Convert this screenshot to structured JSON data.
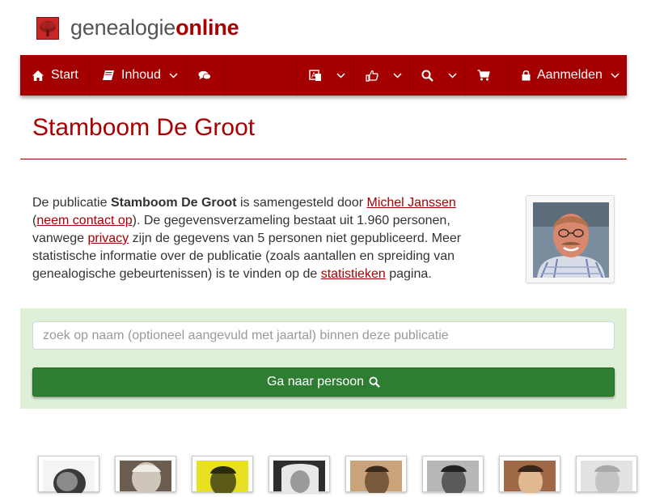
{
  "site": {
    "logo_part1": "genealogie",
    "logo_part2": "online",
    "brand_color": "#a50000"
  },
  "nav": {
    "items": [
      {
        "label": "Start",
        "icon": "home-icon"
      },
      {
        "label": "Inhoud",
        "icon": "book-icon"
      },
      {
        "label": "",
        "icon": "comments-icon"
      },
      {
        "label": "",
        "icon": "language-icon"
      },
      {
        "label": "",
        "icon": "thumbs-up-icon"
      },
      {
        "label": "",
        "icon": "search-icon"
      },
      {
        "label": "",
        "icon": "cart-icon"
      },
      {
        "label": "Aanmelden",
        "icon": "lock-icon"
      }
    ]
  },
  "page": {
    "title": "Stamboom De Groot"
  },
  "intro": {
    "t1": "De publicatie ",
    "pub_name": "Stamboom De Groot",
    "t2": " is samengesteld door ",
    "author": "Michel Janssen",
    "t3": "(",
    "contact": "neem contact op",
    "t4": "). De gegevensverzameling bestaat uit 1.960 personen, vanwege ",
    "privacy": "privacy",
    "t5": " zijn de gegevens van 5 personen niet gepubliceerd. Meer statistische informatie over de publicatie (zoals aantallen en spreiding van genealogische gebeurtenissen) is te vinden op de ",
    "stats": "statistieken",
    "t6": " pagina."
  },
  "search": {
    "placeholder": "zoek op naam (optioneel aangevuld met jaartal) binnen deze publicatie",
    "value": "",
    "button_label": "Ga naar persoon",
    "panel_color": "#dff0d8",
    "button_color": "#2e7d32"
  }
}
